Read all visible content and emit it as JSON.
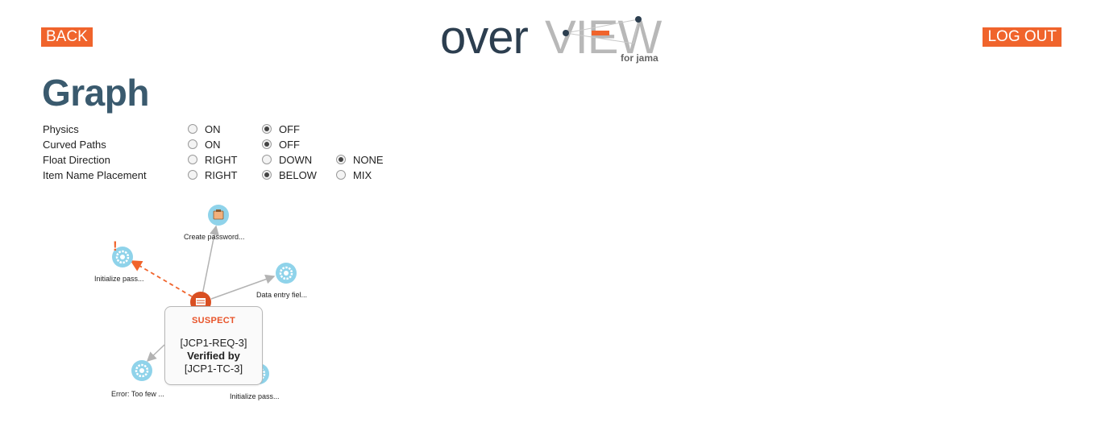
{
  "nav": {
    "back_label": "BACK",
    "logout_label": "LOG OUT"
  },
  "logo": {
    "part1": "over",
    "part2": "VIEW",
    "sub": "for jama",
    "accent_color": "#f0642c"
  },
  "page_title": "Graph",
  "settings": [
    {
      "label": "Physics",
      "options": [
        "ON",
        "OFF"
      ],
      "selected": "OFF"
    },
    {
      "label": "Curved Paths",
      "options": [
        "ON",
        "OFF"
      ],
      "selected": "OFF"
    },
    {
      "label": "Float Direction",
      "options": [
        "RIGHT",
        "DOWN",
        "NONE"
      ],
      "selected": "NONE"
    },
    {
      "label": "Item Name Placement",
      "options": [
        "RIGHT",
        "BELOW",
        "MIX"
      ],
      "selected": "BELOW"
    }
  ],
  "graph": {
    "nodes": [
      {
        "label": "Create password...",
        "icon": "folder-icon"
      },
      {
        "label": "Initialize pass...",
        "icon": "gear-icon",
        "flag": "!"
      },
      {
        "label": "Data entry fiel...",
        "icon": "gear-icon"
      },
      {
        "label": "Error: Too few ...",
        "icon": "gear-icon"
      },
      {
        "label": "Initialize pass...",
        "icon": "gear-icon"
      },
      {
        "label": "",
        "icon": "document-icon"
      }
    ]
  },
  "tooltip": {
    "status": "SUSPECT",
    "line1": "[JCP1-REQ-3]",
    "line2": "Verified by",
    "line3": "[JCP1-TC-3]"
  }
}
